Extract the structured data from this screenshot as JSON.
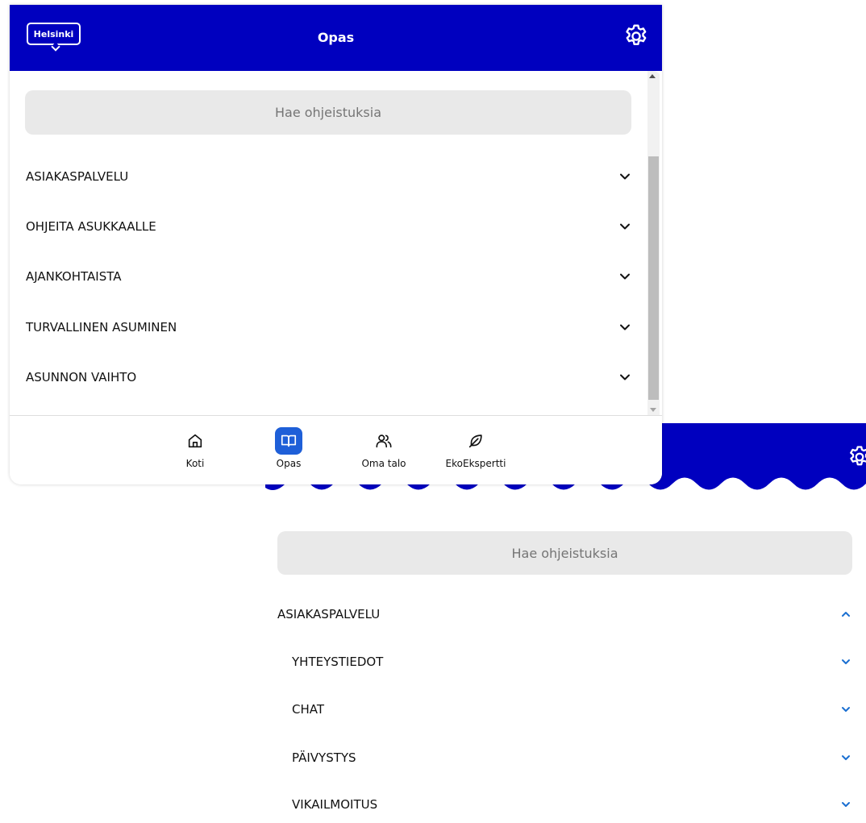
{
  "window1": {
    "logo_text": "Helsinki",
    "title": "Opas",
    "search_placeholder": "Hae ohjeistuksia",
    "accordion": [
      {
        "label": "ASIAKASPALVELU"
      },
      {
        "label": "OHJEITA ASUKKAALLE"
      },
      {
        "label": "AJANKOHTAISTA"
      },
      {
        "label": "TURVALLINEN ASUMINEN"
      },
      {
        "label": "ASUNNON VAIHTO"
      }
    ],
    "nav": [
      {
        "label": "Koti",
        "icon": "home-icon",
        "active": false
      },
      {
        "label": "Opas",
        "icon": "book-icon",
        "active": true
      },
      {
        "label": "Oma talo",
        "icon": "users-icon",
        "active": false
      },
      {
        "label": "EkoEkspertti",
        "icon": "leaf-icon",
        "active": false
      }
    ]
  },
  "window2": {
    "search_placeholder": "Hae ohjeistuksia",
    "section": {
      "label": "ASIAKASPALVELU",
      "expanded": true,
      "items": [
        {
          "label": "YHTEYSTIEDOT"
        },
        {
          "label": "CHAT"
        },
        {
          "label": "PÄIVYSTYS"
        },
        {
          "label": "VIKAILMOITUS"
        }
      ]
    }
  },
  "colors": {
    "brand_blue": "#0000bf",
    "active_nav": "#1e5fd8",
    "chevron_blue": "#1a6fd1",
    "search_bg": "#e9e9e9"
  }
}
